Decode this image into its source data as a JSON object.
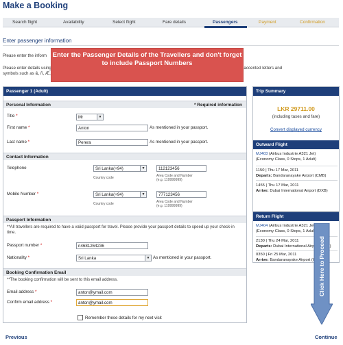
{
  "page": {
    "title": "Make a Booking"
  },
  "steps": [
    {
      "label": "Search flight"
    },
    {
      "label": "Availability"
    },
    {
      "label": "Select flight"
    },
    {
      "label": "Fare details"
    },
    {
      "label": "Passengers"
    },
    {
      "label": "Payment"
    },
    {
      "label": "Confirmation"
    }
  ],
  "section": {
    "title": "Enter passenger information",
    "intro1": "Please enter the inform",
    "intro2": "Please enter details using only English letters and numbers. The booking system is unable to recognise non-English characters, accented letters and",
    "intro3": "symbols such as &, ñ, Æ, ..."
  },
  "callout": {
    "text": "Enter the Passenger Details of the Travellers and don't forget to include Passport Numbers"
  },
  "form": {
    "header": "Passenger 1 (Adult)",
    "personal": {
      "heading": "Personal Information",
      "required": "* Required information",
      "title_label": "Title",
      "title_value": "Mr",
      "first_label": "First name",
      "first_value": "Anton",
      "last_label": "Last name",
      "last_value": "Perera",
      "passport_hint": "As mentioned in your passport."
    },
    "contact": {
      "heading": "Contact Information",
      "tel_label": "Telephone",
      "tel_country": "Sri Lanka(+94)",
      "tel_number": "112123456",
      "mobile_label": "Mobile Number",
      "mobile_country": "Sri Lanka(+94)",
      "mobile_number": "777123456",
      "country_code": "Country code",
      "area_code": "Area Code and Number",
      "example": "(e.g. 119999999)"
    },
    "passport": {
      "heading": "Passport Information",
      "note": "**All travellers are required to have a valid passport for travel. Please provide your passport details to speed up your check-in time.",
      "number_label": "Passport number",
      "number_value": "n4681264236",
      "nationality_label": "Nationality",
      "nationality_value": "Sri Lanka",
      "nationality_hint": "As mentioned in your passport."
    },
    "email": {
      "heading": "Booking Confirmation Email",
      "note": "**The booking confirmation will be sent to this email address.",
      "email_label": "Email address",
      "email_value": "anton@ymail.com",
      "confirm_label": "Confirm email address",
      "confirm_value": "anton@ymail.com",
      "remember": "Remember these details for my next visit"
    }
  },
  "summary": {
    "heading": "Trip Summary",
    "price": "LKR 29711.00",
    "price_note": "(including taxes and fare)",
    "convert": "Convert displayed currency"
  },
  "outward": {
    "heading": "Outward Flight",
    "code": "MJ403",
    "line1": " (Airbus Industrie A321 Jet)",
    "line2": "(Economy Class, 0 Stops, 1 Adult)",
    "dep_time": "1150 | Thu 17 Mar, 2011",
    "dep_label": "Departs:",
    "dep_place": "Bandaranayake Airport (CMB)",
    "arr_time": "1455 | Thu 17 Mar, 2011",
    "arr_label": "Arrive:",
    "arr_place": "Dubai International Airport (DXB)"
  },
  "return": {
    "heading": "Return Flight",
    "code": "MJ404",
    "line1": " (Airbus Industrie A321 Jet)",
    "line2": "(Economy Class, 0 Stops, 1 Adult)",
    "dep_time": "2130 | Thu 24 Mar, 2011",
    "dep_label": "Departs:",
    "dep_place": "Dubai International Airport (DXB)",
    "arr_time": "0350 | Fri 25 Mar, 2011",
    "arr_label": "Arrive:",
    "arr_place": "Bandaranayake Airport (CMB)"
  },
  "proceed": {
    "text": "Click Here to Proceed"
  },
  "nav": {
    "previous": "Previous",
    "continue": "Continue"
  },
  "icons": {
    "dropdown": "chevron-down-icon",
    "proceed_arrow": "arrow-down-icon"
  },
  "colors": {
    "brand": "#1e3f7a",
    "callout": "#d9534f",
    "step_future": "#d19a1f",
    "proceed_arrow": "#6f91c4"
  }
}
